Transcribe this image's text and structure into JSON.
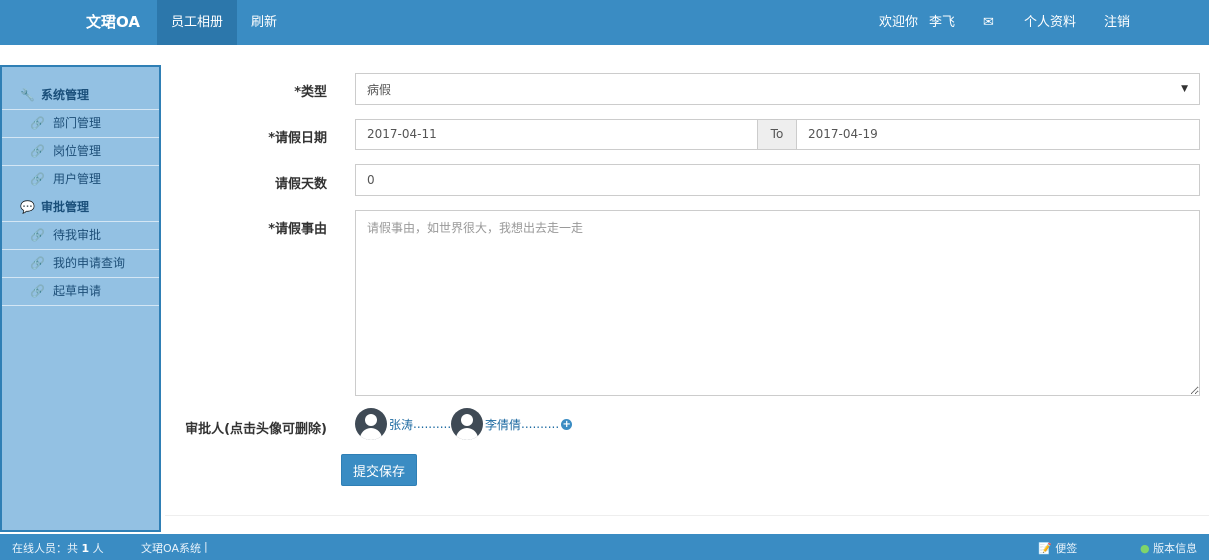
{
  "navbar": {
    "brand": "文珺OA",
    "active_nav": "员工相册",
    "refresh": "刷新",
    "welcome": "欢迎你",
    "user_name": "李飞",
    "mail_icon": "envelope-icon",
    "profile": "个人资料",
    "logout": "注销"
  },
  "sidebar": {
    "groups": [
      {
        "title": "系统管理",
        "icon": "wrench-icon",
        "items": [
          {
            "label": "部门管理"
          },
          {
            "label": "岗位管理"
          },
          {
            "label": "用户管理"
          }
        ]
      },
      {
        "title": "审批管理",
        "icon": "chat-icon",
        "items": [
          {
            "label": "待我审批"
          },
          {
            "label": "我的申请查询"
          },
          {
            "label": "起草申请"
          }
        ]
      }
    ]
  },
  "form": {
    "type_label": "*类型",
    "type_value": "病假",
    "date_label": "*请假日期",
    "start_date": "2017-04-11",
    "to_label": "To",
    "end_date": "2017-04-19",
    "days_label": "请假天数",
    "days_value": "0",
    "reason_label": "*请假事由",
    "reason_placeholder": "请假事由，如世界很大，我想出去走一走",
    "approver_label": "审批人(点击头像可删除)",
    "approvers": [
      {
        "name": "张涛"
      },
      {
        "name": "李倩倩"
      }
    ],
    "approver_dots": "..........",
    "submit_label": "提交保存"
  },
  "footer": {
    "online_prefix": "在线人员：共",
    "online_count": "1",
    "online_suffix": "人",
    "system_name": "文珺OA系统",
    "divider": "|",
    "notes": "便签",
    "version": "版本信息"
  },
  "colors": {
    "primary": "#3a8cc3",
    "sidebar_bg": "#93c1e3",
    "active_nav_bg": "#2c77ab"
  }
}
